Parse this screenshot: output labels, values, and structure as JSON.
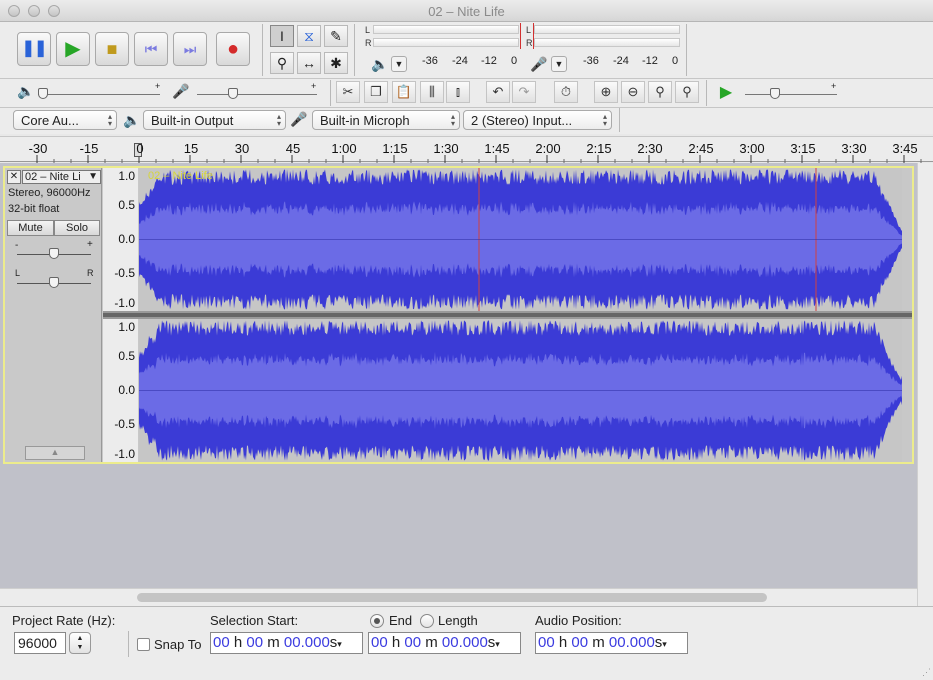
{
  "window": {
    "title": "02 – Nite Life"
  },
  "meters": {
    "playback_channels": [
      "L",
      "R"
    ],
    "record_channels": [
      "L",
      "R"
    ],
    "playback_scale": [
      "-36",
      "-24",
      "-12",
      "0"
    ],
    "record_scale": [
      "-36",
      "-24",
      "-12",
      "0"
    ]
  },
  "device_toolbar": {
    "host": "Core Au...",
    "output_device": "Built-in Output",
    "input_device": "Built-in Microph",
    "input_channels": "2 (Stereo) Input..."
  },
  "timeline": {
    "ticks": [
      "-30",
      "-15",
      "0",
      "15",
      "30",
      "45",
      "1:00",
      "1:15",
      "1:30",
      "1:45",
      "2:00",
      "2:15",
      "2:30",
      "2:45",
      "3:00",
      "3:15",
      "3:30",
      "3:45"
    ]
  },
  "track": {
    "name": "02 – Nite Li",
    "label": "02 – Nite Life",
    "format_line1": "Stereo, 96000Hz",
    "format_line2": "32-bit float",
    "mute_label": "Mute",
    "solo_label": "Solo",
    "gain_minus": "-",
    "gain_plus": "+",
    "pan_left": "L",
    "pan_right": "R",
    "vruler": [
      "1.0",
      "0.5",
      "0.0",
      "-0.5",
      "-1.0"
    ],
    "wave_color": "#3b3bd6",
    "rms_color": "#6b6be6"
  },
  "selection_toolbar": {
    "project_rate_label": "Project Rate (Hz):",
    "project_rate_value": "96000",
    "snap_to_label": "Snap To",
    "selection_start_label": "Selection Start:",
    "end_label": "End",
    "length_label": "Length",
    "audio_position_label": "Audio Position:",
    "selection_start": {
      "h": "00",
      "h_unit": "h",
      "m": "00",
      "m_unit": "m",
      "s": "00.000",
      "s_unit": "s"
    },
    "selection_end": {
      "h": "00",
      "h_unit": "h",
      "m": "00",
      "m_unit": "m",
      "s": "00.000",
      "s_unit": "s"
    },
    "audio_position": {
      "h": "00",
      "h_unit": "h",
      "m": "00",
      "m_unit": "m",
      "s": "00.000",
      "s_unit": "s"
    }
  }
}
